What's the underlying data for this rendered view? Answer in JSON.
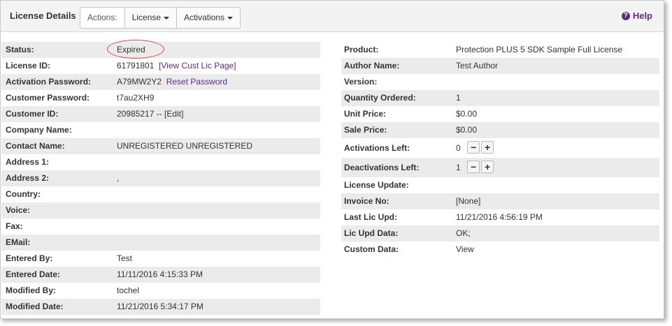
{
  "header": {
    "title": "License Details",
    "actions_label": "Actions:",
    "license_menu": "License",
    "activations_menu": "Activations",
    "help": "Help"
  },
  "left": [
    {
      "label": "Status:",
      "value": "Expired"
    },
    {
      "label": "License ID:",
      "value": "61791801",
      "link": "[View Cust Lic Page]"
    },
    {
      "label": "Activation Password:",
      "value": "A79MW2Y2",
      "link": "Reset Password"
    },
    {
      "label": "Customer Password:",
      "value": "t7au2XH9"
    },
    {
      "label": "Customer ID:",
      "link": "20985217 -- [Edit]"
    },
    {
      "label": "Company Name:",
      "value": ""
    },
    {
      "label": "Contact Name:",
      "value": "UNREGISTERED UNREGISTERED"
    },
    {
      "label": "Address 1:",
      "value": ""
    },
    {
      "label": "Address 2:",
      "value": ","
    },
    {
      "label": "Country:",
      "value": ""
    },
    {
      "label": "Voice:",
      "value": ""
    },
    {
      "label": "Fax:",
      "value": ""
    },
    {
      "label": "EMail:",
      "value": ""
    },
    {
      "label": "Entered By:",
      "value": "Test"
    },
    {
      "label": "Entered Date:",
      "value": "11/11/2016 4:15:33 PM"
    },
    {
      "label": "Modified By:",
      "value": "tochel"
    },
    {
      "label": "Modified Date:",
      "value": "11/21/2016 5:34:17 PM"
    }
  ],
  "right": [
    {
      "label": "Product:",
      "link": "Protection PLUS 5 SDK Sample Full License"
    },
    {
      "label": "Author Name:",
      "value": "Test Author"
    },
    {
      "label": "Version:",
      "value": ""
    },
    {
      "label": "Quantity Ordered:",
      "value": "1"
    },
    {
      "label": "Unit Price:",
      "value": "$0.00"
    },
    {
      "label": "Sale Price:",
      "value": "$0.00"
    },
    {
      "label": "Activations Left:",
      "value": "0"
    },
    {
      "label": "Deactivations Left:",
      "value": "1"
    },
    {
      "label": "License Update:",
      "value": ""
    },
    {
      "label": "Invoice No:",
      "value": "[None]"
    },
    {
      "label": "Last Lic Upd:",
      "value": "11/21/2016 4:56:19 PM"
    },
    {
      "label": "Lic Upd Data:",
      "value": "OK;"
    },
    {
      "label": "Custom Data:",
      "link": "View"
    }
  ],
  "stepper": {
    "minus": "−",
    "plus": "+"
  }
}
